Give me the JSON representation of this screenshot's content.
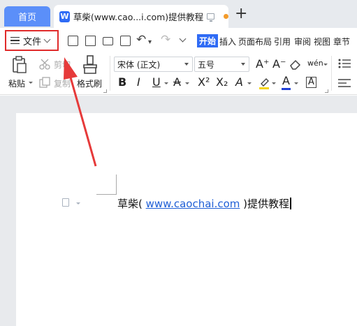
{
  "tabbar": {
    "home_tab": "首页",
    "doc_tab_title": "草柴(www.cao...i.com)提供教程",
    "new_tab_icon": "plus-icon"
  },
  "toolbar": {
    "file_menu_label": "文件",
    "ribbon_tabs": [
      "开始",
      "插入",
      "页面布局",
      "引用",
      "审阅",
      "视图",
      "章节"
    ],
    "active_tab": "开始"
  },
  "ribbon": {
    "paste_label": "粘贴",
    "cut_label": "剪切",
    "copy_label": "复制",
    "format_painter_label": "格式刷",
    "font_family": "宋体 (正文)",
    "font_size": "五号",
    "bold": "B",
    "italic": "I",
    "underline": "U",
    "strikethrough": "A",
    "superscript": "X²",
    "subscript": "X₂",
    "text_effect": "A",
    "font_color": "A",
    "char_border": "A",
    "grow_font": "A⁺",
    "shrink_font": "A⁻",
    "pinyin": "wén"
  },
  "document": {
    "prefix": "草柴(",
    "link_text": "www.caochai.com",
    "suffix": ")提供教程"
  },
  "colors": {
    "accent": "#2f6bf5",
    "home_tab": "#5b8ff9",
    "annotation": "#e02b2b",
    "link": "#1f5fd6"
  }
}
